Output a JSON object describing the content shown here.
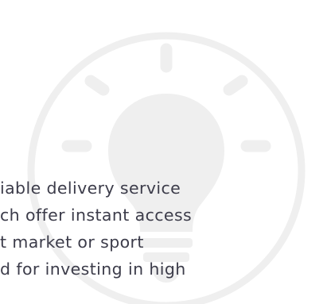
{
  "colors": {
    "background": "#ffffff",
    "illustration": "#efefef",
    "text": "#3c3c4a"
  },
  "illustration": {
    "icon": "lightbulb-icon"
  },
  "text_lines": [
    "iable delivery service",
    "ch offer instant access",
    "t market or sport",
    "d for investing in high"
  ]
}
